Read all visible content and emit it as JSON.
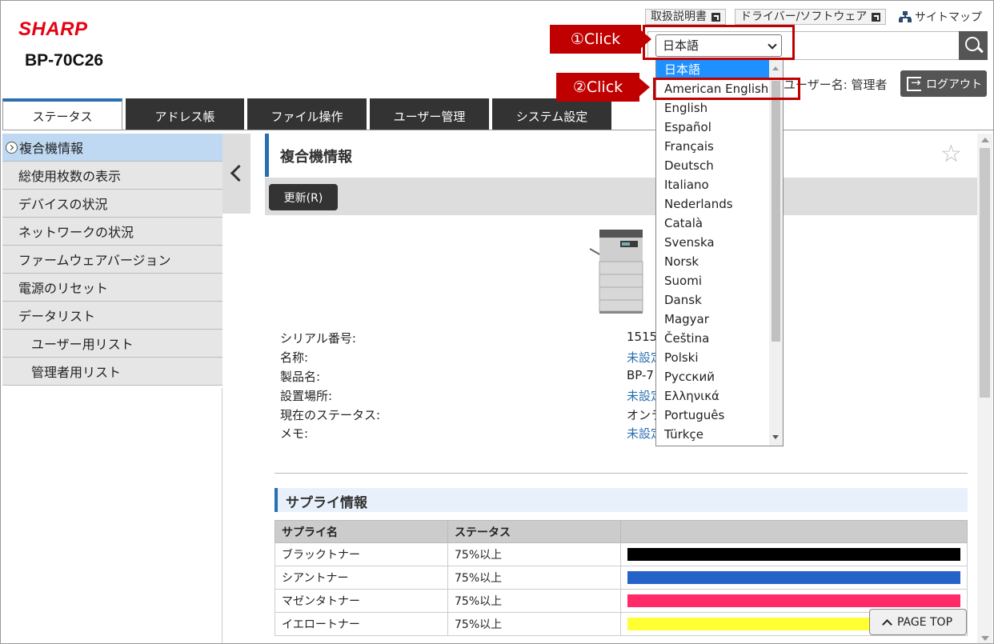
{
  "brand": "SHARP",
  "model": "BP-70C26",
  "top_links": {
    "manual": "取扱説明書",
    "driver": "ドライバー/ソフトウェア",
    "sitemap": "サイトマップ"
  },
  "language": {
    "selected": "日本語",
    "options": [
      "日本語",
      "American English",
      "English",
      "Español",
      "Français",
      "Deutsch",
      "Italiano",
      "Nederlands",
      "Català",
      "Svenska",
      "Norsk",
      "Suomi",
      "Dansk",
      "Magyar",
      "Čeština",
      "Polski",
      "Русский",
      "Ελληνικά",
      "Português",
      "Türkçe"
    ]
  },
  "user": {
    "label": "ユーザー名: 管理者",
    "logout": "ログアウト"
  },
  "tabs": [
    "ステータス",
    "アドレス帳",
    "ファイル操作",
    "ユーザー管理",
    "システム設定"
  ],
  "sidebar": {
    "items": [
      {
        "label": "複合機情報"
      },
      {
        "label": "総使用枚数の表示"
      },
      {
        "label": "デバイスの状況"
      },
      {
        "label": "ネットワークの状況"
      },
      {
        "label": "ファームウェアバージョン"
      },
      {
        "label": "電源のリセット"
      },
      {
        "label": "データリスト"
      },
      {
        "label": "ユーザー用リスト"
      },
      {
        "label": "管理者用リスト"
      }
    ]
  },
  "main": {
    "title": "複合機情報",
    "refresh": "更新(R)",
    "info": [
      {
        "label": "シリアル番号:",
        "value": "1515"
      },
      {
        "label": "名称:",
        "value": "未設定"
      },
      {
        "label": "製品名:",
        "value": "BP-7"
      },
      {
        "label": "設置場所:",
        "value": "未設定"
      },
      {
        "label": "現在のステータス:",
        "value": "オンラ"
      },
      {
        "label": "メモ:",
        "value": "未設定"
      }
    ],
    "supply_title": "サプライ情報",
    "supply_headers": [
      "サプライ名",
      "ステータス"
    ],
    "supplies": [
      {
        "name": "ブラックトナー",
        "status": "75%以上",
        "color": "#000000"
      },
      {
        "name": "シアントナー",
        "status": "75%以上",
        "color": "#2563c8"
      },
      {
        "name": "マゼンタトナー",
        "status": "75%以上",
        "color": "#ff2a6a"
      },
      {
        "name": "イエロートナー",
        "status": "75%以上",
        "color": "#ffff33"
      }
    ],
    "page_top": "PAGE TOP"
  },
  "annotations": {
    "step1": "①Click",
    "step2": "②Click",
    "color": "#c00000"
  }
}
